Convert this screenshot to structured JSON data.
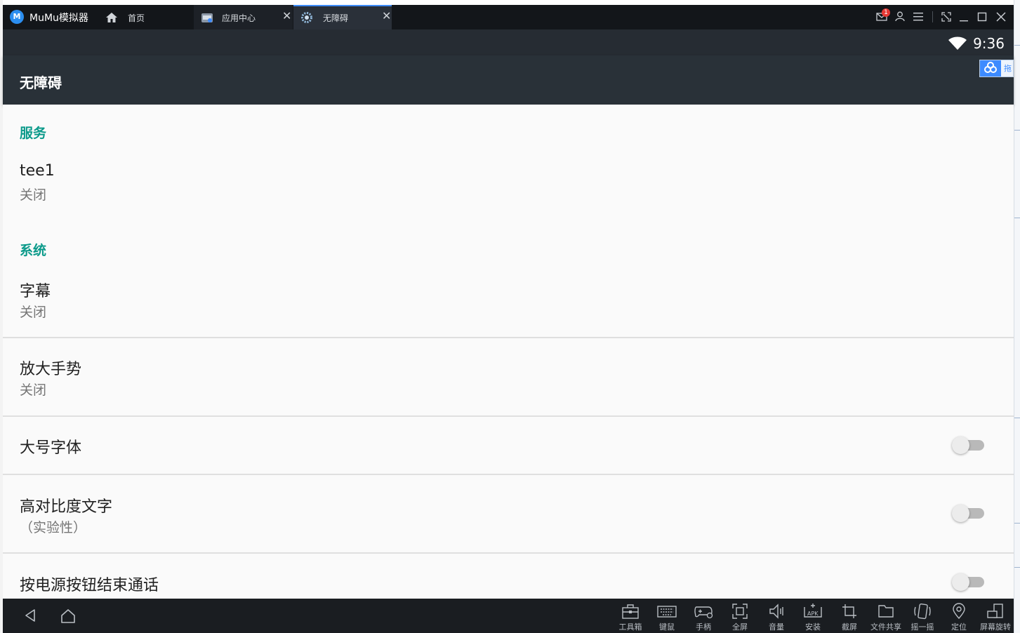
{
  "titlebar": {
    "app_name": "MuMu模拟器",
    "logo_text": "M",
    "tabs": [
      {
        "label": "首页"
      },
      {
        "label": "应用中心",
        "close": "✕"
      },
      {
        "label": "无障碍",
        "close": "✕"
      }
    ],
    "notification_count": "1",
    "icons": [
      "mail-icon",
      "user-icon",
      "menu-icon",
      "shrink-icon",
      "minimize-icon",
      "maximize-icon",
      "close-icon"
    ]
  },
  "statusbar": {
    "time": "9:36"
  },
  "actionbar": {
    "title": "无障碍"
  },
  "side_widget": {
    "text": "拖"
  },
  "content": {
    "section_services": "服务",
    "service_item": {
      "title": "tee1",
      "status": "关闭"
    },
    "section_system": "系统",
    "captions": {
      "title": "字幕",
      "status": "关闭"
    },
    "magnification": {
      "title": "放大手势",
      "status": "关闭"
    },
    "large_text": {
      "title": "大号字体",
      "checked": false
    },
    "high_contrast": {
      "title": "高对比度文字",
      "subtitle": "（实验性）",
      "checked": false
    },
    "power_end_call": {
      "title": "按电源按钮结束通话",
      "checked": false
    }
  },
  "navbar": {
    "tools": [
      {
        "label": "工具箱",
        "icon": "toolbox-icon"
      },
      {
        "label": "键鼠",
        "icon": "keyboard-icon"
      },
      {
        "label": "手柄",
        "icon": "gamepad-icon"
      },
      {
        "label": "全屏",
        "icon": "fullscreen-icon"
      },
      {
        "label": "音量",
        "icon": "volume-icon"
      },
      {
        "label": "安装",
        "icon": "apk-install-icon"
      },
      {
        "label": "截屏",
        "icon": "screenshot-icon"
      },
      {
        "label": "文件共享",
        "icon": "folder-share-icon"
      },
      {
        "label": "摇一摇",
        "icon": "shake-icon"
      },
      {
        "label": "定位",
        "icon": "location-icon"
      },
      {
        "label": "屏幕旋转",
        "icon": "rotate-icon"
      }
    ]
  },
  "colors": {
    "accent": "#0b9a8a",
    "actionbar": "#293138",
    "statusbar": "#262c33",
    "titlebar": "#13161a",
    "navbar": "#1a1d21",
    "tab_highlight": "#3d8bff"
  }
}
